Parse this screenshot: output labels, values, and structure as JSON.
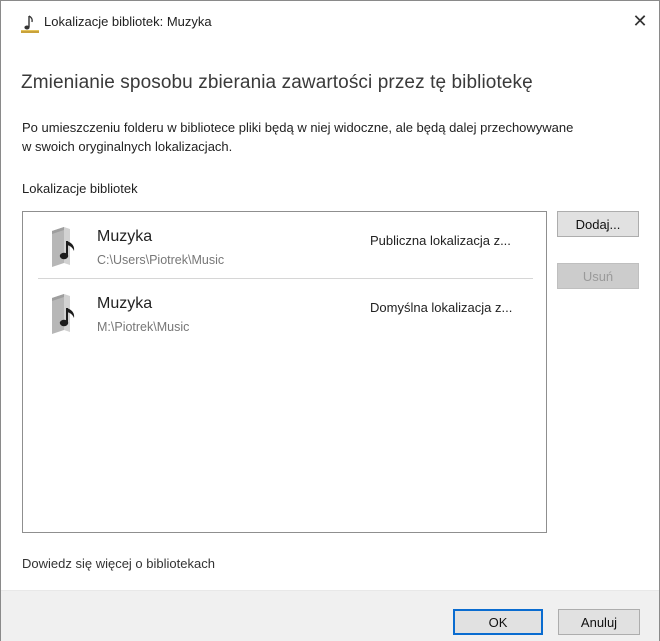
{
  "window": {
    "title": "Lokalizacje bibliotek: Muzyka",
    "close_glyph": "✕",
    "title_icon": "music-note-icon"
  },
  "heading": "Zmienianie sposobu zbierania zawartości przez tę bibliotekę",
  "description": "Po umieszczeniu folderu w bibliotece pliki będą w niej widoczne, ale będą dalej przechowywane w swoich oryginalnych lokalizacjach.",
  "locations": {
    "label": "Lokalizacje bibliotek",
    "items": [
      {
        "name": "Muzyka",
        "path": "C:\\Users\\Piotrek\\Music",
        "description": "Publiczna lokalizacja z...",
        "icon": "music-folder-icon"
      },
      {
        "name": "Muzyka",
        "path": "M:\\Piotrek\\Music",
        "description": "Domyślna lokalizacja z...",
        "icon": "music-folder-icon"
      }
    ]
  },
  "buttons": {
    "add": "Dodaj...",
    "remove": "Usuń",
    "ok": "OK",
    "cancel": "Anuluj"
  },
  "learn_more_link": "Dowiedz się więcej o bibliotekach",
  "colors": {
    "focus_border": "#0a6cd0",
    "footer_bg": "#f0f0f0",
    "disabled_text": "#9a9a9a"
  }
}
